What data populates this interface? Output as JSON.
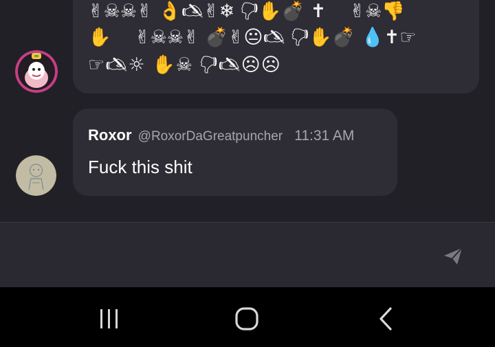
{
  "messages": [
    {
      "avatar_icon": "pink-character-avatar",
      "emoji_lines": [
        "✌☠☠✌ 👌🖎✌❄ 🖓✋💣 ✝    ✌☠👎",
        "✋    ✌☠☠✌ 💣✌😐🖎 🖓✋💣 💧✝☞",
        "☞🖎☼ ✋☠ 🖓🖎☹☹"
      ]
    },
    {
      "avatar_icon": "sketch-character-avatar",
      "author": "Roxor",
      "handle": "@RoxorDaGreatpuncher",
      "time": "11:31 AM",
      "text": "Fuck this shit"
    }
  ],
  "composer": {
    "send_icon": "send-icon"
  },
  "navbar": {
    "recent_icon": "recent-apps-icon",
    "home_icon": "home-icon",
    "back_icon": "back-icon"
  },
  "colors": {
    "background": "#222027",
    "bubble": "#2e2c34",
    "composer": "#2a2830",
    "navbar": "#000000",
    "text": "#ffffff",
    "muted": "#a8a6ad"
  }
}
